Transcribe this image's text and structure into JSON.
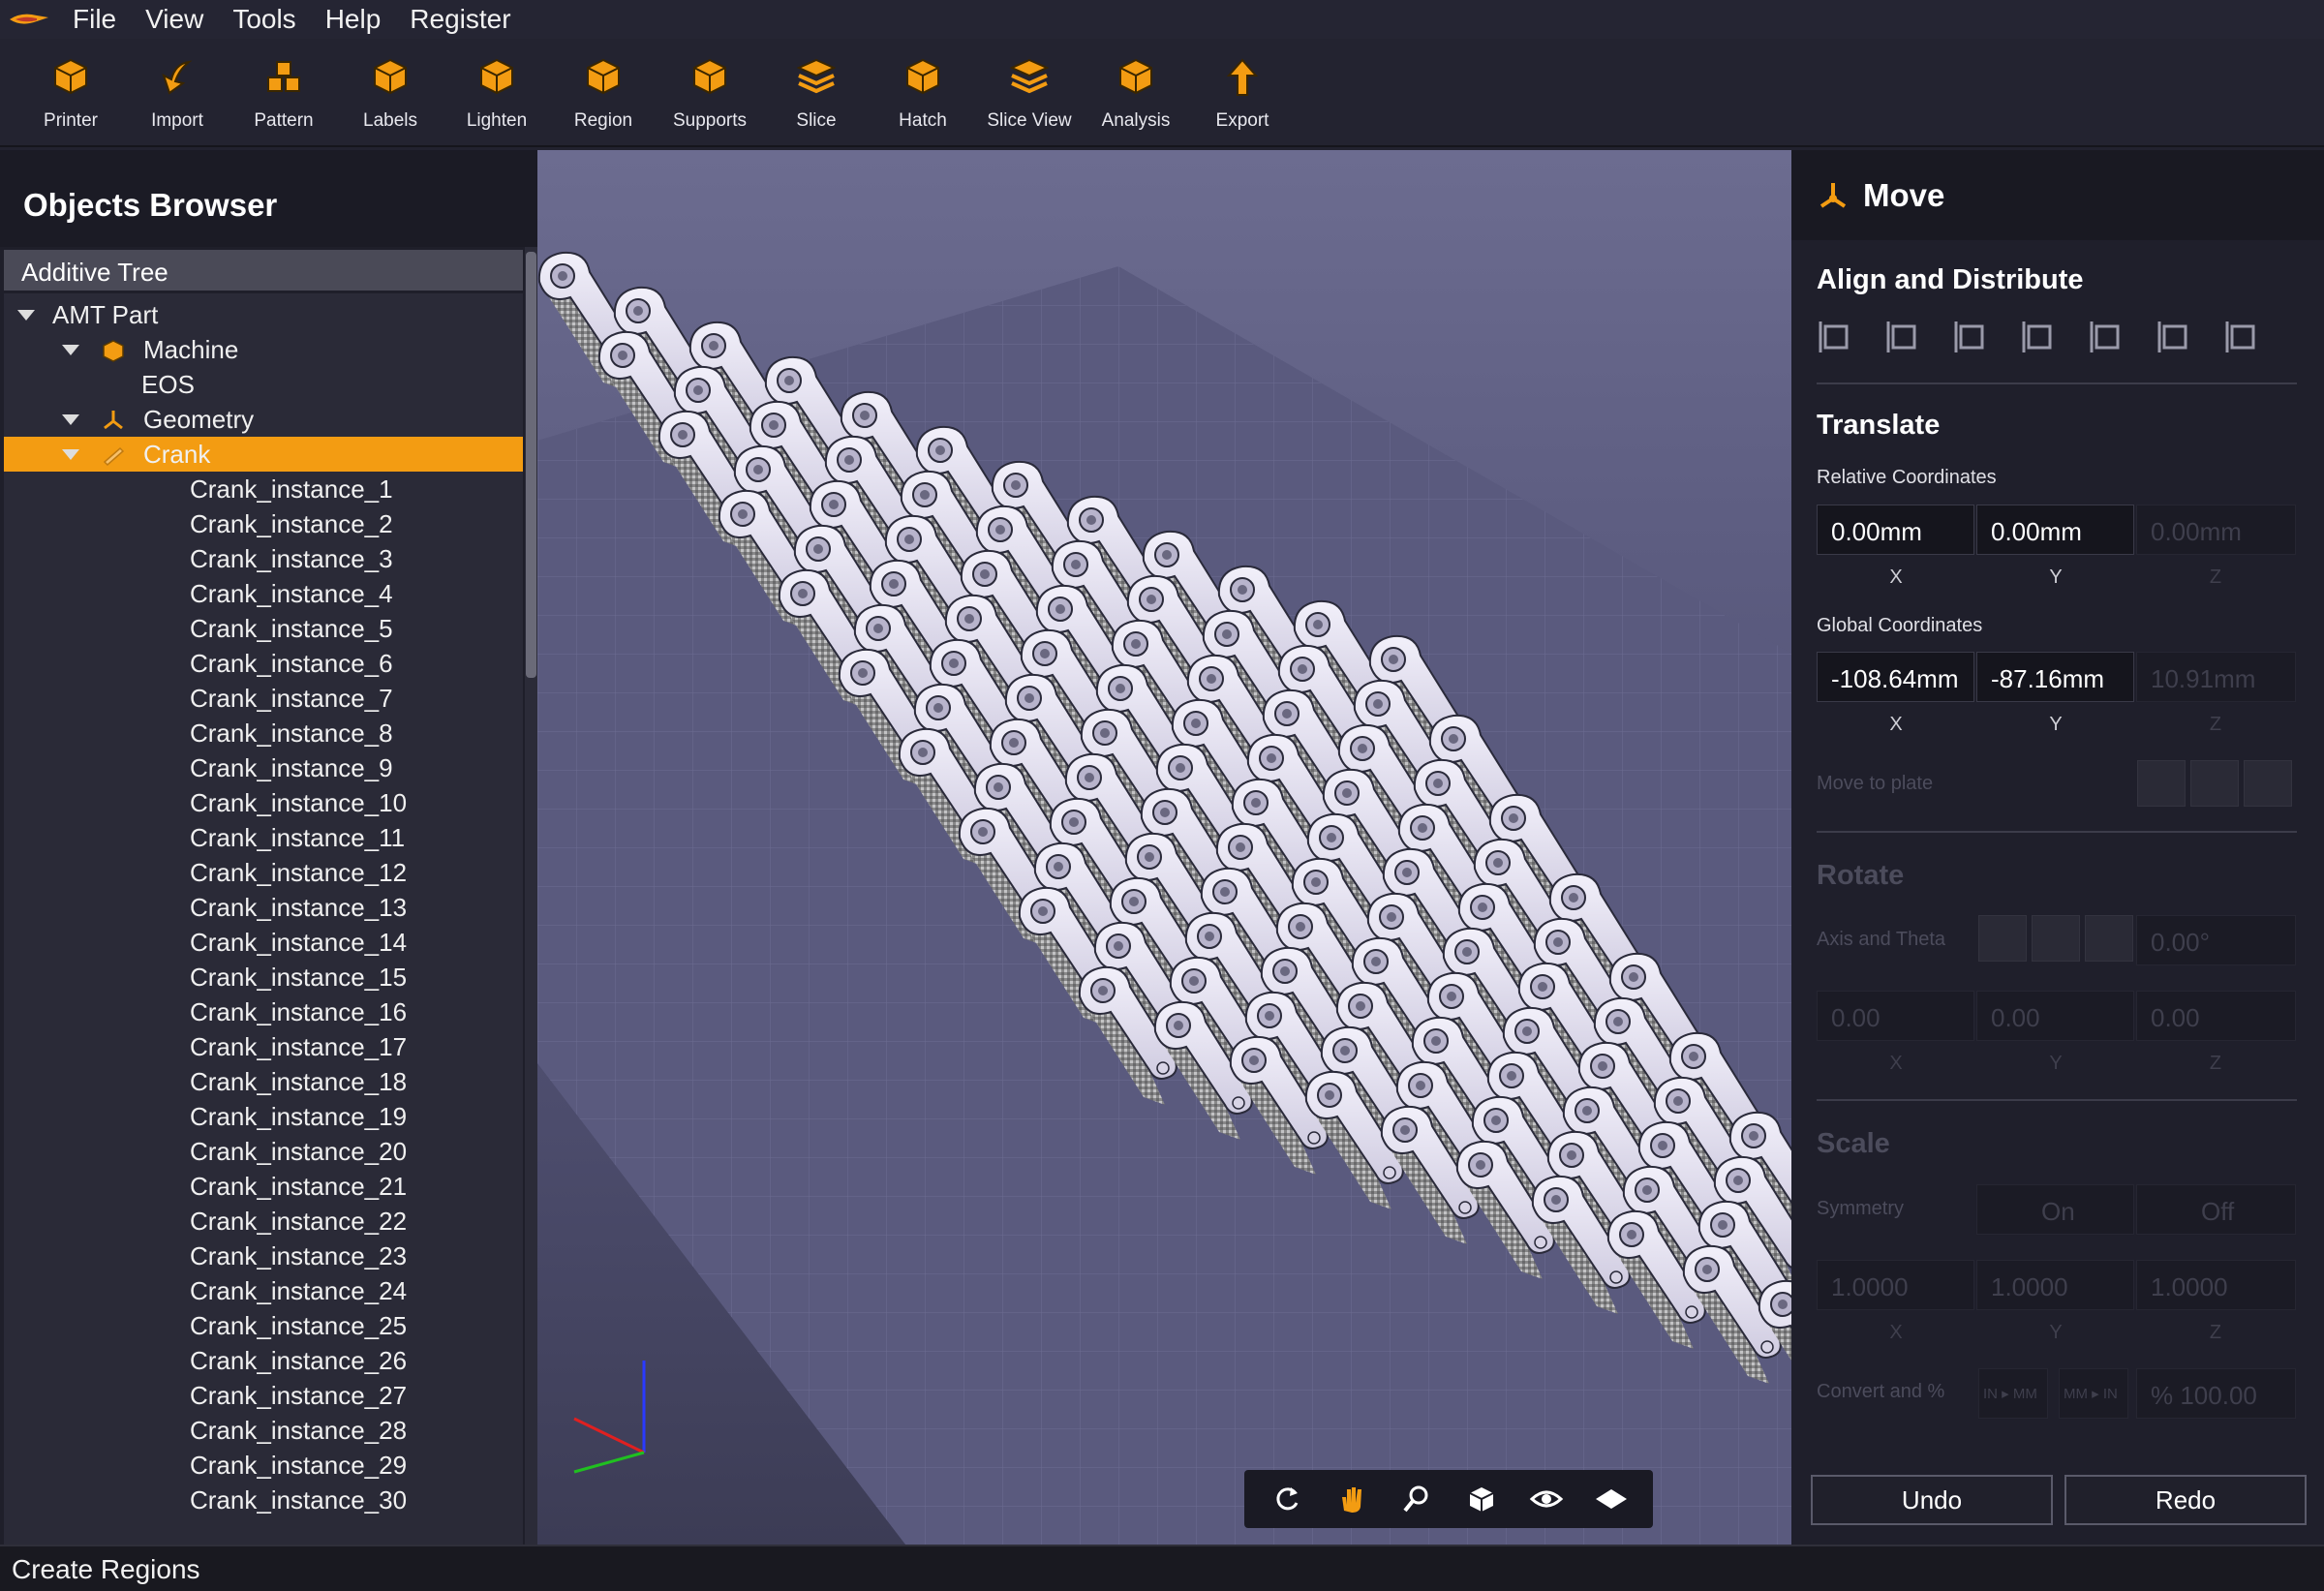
{
  "menu": [
    "File",
    "View",
    "Tools",
    "Help",
    "Register"
  ],
  "toolbar": [
    {
      "label": "Printer",
      "icon": "printer-cube-icon"
    },
    {
      "label": "Import",
      "icon": "import-arrow-icon"
    },
    {
      "label": "Pattern",
      "icon": "pattern-blocks-icon"
    },
    {
      "label": "Labels",
      "icon": "labels-cubes-icon"
    },
    {
      "label": "Lighten",
      "icon": "lighten-cube-icon"
    },
    {
      "label": "Region",
      "icon": "region-cube-icon"
    },
    {
      "label": "Supports",
      "icon": "supports-cube-icon"
    },
    {
      "label": "Slice",
      "icon": "slice-layers-icon"
    },
    {
      "label": "Hatch",
      "icon": "hatch-cube-icon"
    },
    {
      "label": "Slice View",
      "icon": "slice-view-icon"
    },
    {
      "label": "Analysis",
      "icon": "analysis-icon"
    },
    {
      "label": "Export",
      "icon": "export-arrow-icon"
    }
  ],
  "objects_browser": {
    "title": "Objects Browser",
    "tree_header": "Additive Tree",
    "nodes": [
      {
        "label": "AMT Part",
        "level": 0,
        "expanded": true
      },
      {
        "label": "Machine",
        "level": 1,
        "expanded": true,
        "icon": "machine-icon"
      },
      {
        "label": "EOS",
        "level": 2
      },
      {
        "label": "Geometry",
        "level": 1,
        "expanded": true,
        "icon": "geometry-icon"
      },
      {
        "label": "Crank",
        "level": 2,
        "expanded": true,
        "selected": true,
        "icon": "part-icon"
      }
    ],
    "instances": [
      "Crank_instance_1",
      "Crank_instance_2",
      "Crank_instance_3",
      "Crank_instance_4",
      "Crank_instance_5",
      "Crank_instance_6",
      "Crank_instance_7",
      "Crank_instance_8",
      "Crank_instance_9",
      "Crank_instance_10",
      "Crank_instance_11",
      "Crank_instance_12",
      "Crank_instance_13",
      "Crank_instance_14",
      "Crank_instance_15",
      "Crank_instance_16",
      "Crank_instance_17",
      "Crank_instance_18",
      "Crank_instance_19",
      "Crank_instance_20",
      "Crank_instance_21",
      "Crank_instance_22",
      "Crank_instance_23",
      "Crank_instance_24",
      "Crank_instance_25",
      "Crank_instance_26",
      "Crank_instance_27",
      "Crank_instance_28",
      "Crank_instance_29",
      "Crank_instance_30"
    ]
  },
  "viewport_tools": [
    "rotate-icon",
    "pan-hand-icon",
    "zoom-icon",
    "cube-view-icon",
    "visibility-eye-icon",
    "plate-view-icon"
  ],
  "move_panel": {
    "title": "Move",
    "align": {
      "title": "Align and Distribute"
    },
    "translate": {
      "title": "Translate",
      "relative_label": "Relative Coordinates",
      "relative": {
        "x": "0.00mm",
        "y": "0.00mm",
        "z": "0.00mm"
      },
      "global_label": "Global Coordinates",
      "global": {
        "x": "-108.64mm",
        "y": "-87.16mm",
        "z": "10.91mm"
      },
      "axes": {
        "x": "X",
        "y": "Y",
        "z": "Z"
      },
      "move_to_plate": "Move to plate"
    },
    "rotate": {
      "title": "Rotate",
      "axis_label": "Axis and Theta",
      "theta": "0.00°",
      "values": {
        "x": "0.00",
        "y": "0.00",
        "z": "0.00"
      }
    },
    "scale": {
      "title": "Scale",
      "symmetry_label": "Symmetry",
      "on": "On",
      "off": "Off",
      "values": {
        "x": "1.0000",
        "y": "1.0000",
        "z": "1.0000"
      },
      "convert_label": "Convert and %",
      "in_mm": "IN ▸ MM",
      "mm_in": "MM ▸ IN",
      "percent": "% 100.00"
    },
    "undo": "Undo",
    "redo": "Redo"
  },
  "status": "Create Regions",
  "colors": {
    "accent": "#f39c12",
    "panel": "#1f1f2b",
    "viewport": "#5c5c80"
  }
}
